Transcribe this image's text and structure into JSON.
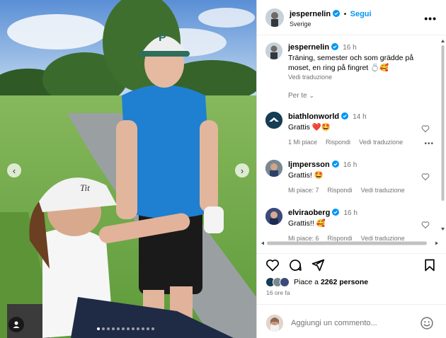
{
  "post": {
    "carousel_dots": 12,
    "active_dot": 0,
    "icons": {
      "prev": "chevron-left-icon",
      "next": "chevron-right-icon",
      "tag": "user-tag-icon"
    }
  },
  "header": {
    "username": "jespernelin",
    "follow_label": "Segui",
    "separator": "•",
    "location": "Sverige",
    "more": "•••"
  },
  "caption": {
    "username": "jespernelin",
    "time": "16 h",
    "text": "Träning, semester och som grädde på moset, en ring på fingret 💍🥰",
    "translate": "Vedi traduzione",
    "for_you": "Per te"
  },
  "comments": [
    {
      "username": "biathlonworld",
      "time": "14 h",
      "text": "Grattis ❤️🤩",
      "likes": "1 Mi piace",
      "reply": "Rispondi",
      "translate": "Vedi traduzione"
    },
    {
      "username": "ljmpersson",
      "time": "16 h",
      "text": "Grattis! 🤩",
      "likes": "Mi piace: 7",
      "reply": "Rispondi",
      "translate": "Vedi traduzione"
    },
    {
      "username": "elviraoberg",
      "time": "16 h",
      "text": "Grattis!! 🥰",
      "likes": "Mi piace: 6",
      "reply": "Rispondi",
      "translate": "Vedi traduzione"
    }
  ],
  "actions": {
    "like": "heart-icon",
    "comment": "comment-icon",
    "share": "share-icon",
    "save": "bookmark-icon"
  },
  "likes": {
    "prefix": "Piace a",
    "count": "2262 persone"
  },
  "timestamp": "16 ore fa",
  "add_comment": {
    "placeholder": "Aggiungi un commento...",
    "emoji_icon": "emoji-icon"
  },
  "colors": {
    "accent": "#0095f6",
    "verified": "#0095f6",
    "muted": "#737373",
    "red_heart": "#ed4956"
  }
}
